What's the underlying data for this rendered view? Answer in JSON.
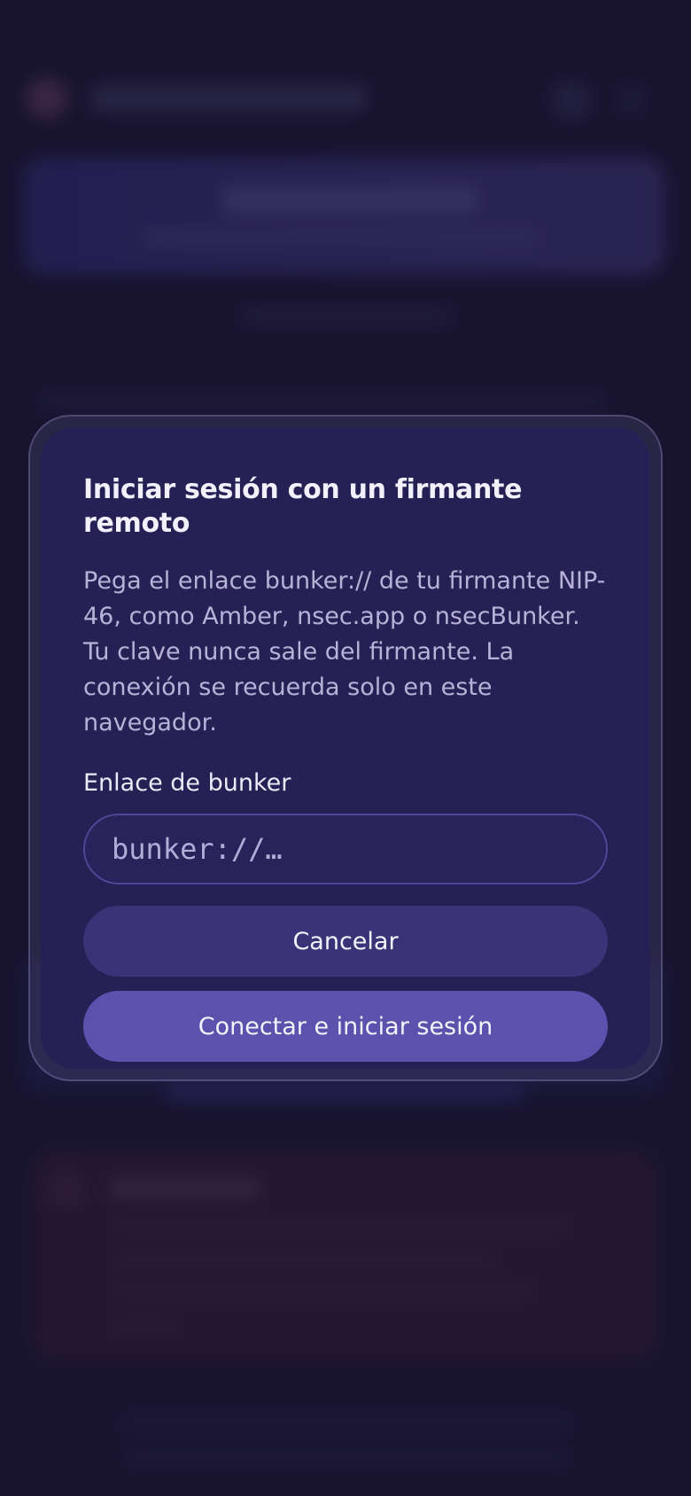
{
  "modal": {
    "title": "Iniciar sesión con un firmante remoto",
    "description": "Pega el enlace bunker:// de tu firmante NIP-46, como Amber, nsec.app o nsecBunker. Tu clave nunca sale del firmante. La conexión se recuerda solo en este navegador.",
    "field_label": "Enlace de bunker",
    "input": {
      "value": "",
      "placeholder": "bunker://…"
    },
    "cancel_label": "Cancelar",
    "connect_label": "Conectar e iniciar sesión"
  },
  "colors": {
    "background": "#1c1836",
    "modal_surface": "#262154",
    "cancel_button": "#3a3378",
    "primary_button": "#5c51ac",
    "text_primary": "#f2f0fa",
    "text_secondary": "#b8b2d8"
  }
}
